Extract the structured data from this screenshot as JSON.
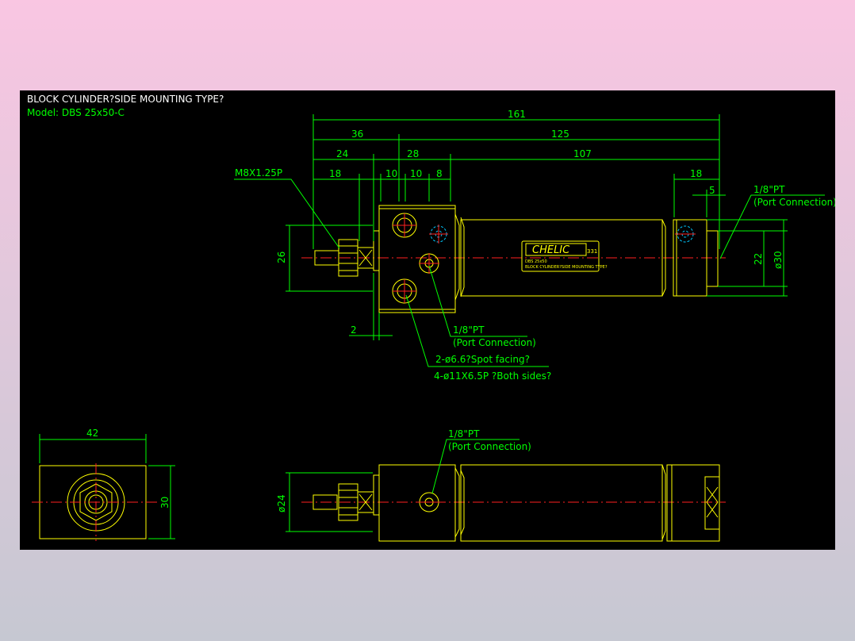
{
  "drawing": {
    "title": "BLOCK CYLINDER?SIDE MOUNTING TYPE?",
    "model": "Model: DBS 25x50-C"
  },
  "dimensions": {
    "overall": "161",
    "d36": "36",
    "d125": "125",
    "d24": "24",
    "d28": "28",
    "d107": "107",
    "d18_left": "18",
    "d10_a": "10",
    "d10_b": "10",
    "d8": "8",
    "d18_right": "18",
    "d5": "5",
    "d26": "26",
    "d22": "22",
    "d30_dia": "ø30",
    "d2": "2",
    "d42": "42",
    "d30_end": "30",
    "d24_dia": "ø24"
  },
  "callouts": {
    "thread": "M8X1.25P",
    "port_top_right": "1/8\"PT",
    "port_top_right_note": "(Port Connection)",
    "port_mid": "1/8\"PT",
    "port_mid_note": "(Port Connection)",
    "spot_facing": "2-ø6.6?Spot facing?",
    "counterbore": "4-ø11X6.5P ?Both sides?",
    "port_bottom": "1/8\"PT",
    "port_bottom_note": "(Port Connection)"
  },
  "label_plate": {
    "brand": "CHELIC",
    "code": "331",
    "line1": "DBS 25x50",
    "line2": "BLOCK CYLINDER?SIDE MOUNTING TYPE?"
  },
  "colors": {
    "background": "#000000",
    "dimension": "#00ff00",
    "outline": "#ffff00",
    "centerline": "#ff2020",
    "hidden": "#00c8ff"
  }
}
